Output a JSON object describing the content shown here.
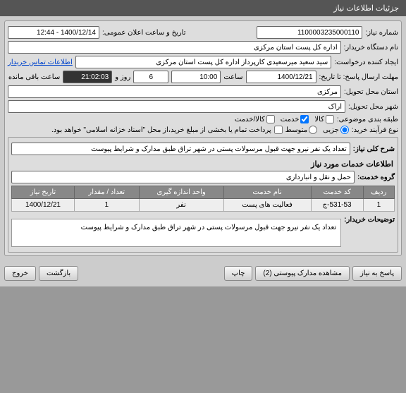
{
  "titlebar": "جزئیات اطلاعات نیاز",
  "fields": {
    "need_no_label": "شماره نیاز:",
    "need_no": "1100003235000110",
    "announce_label": "تاریخ و ساعت اعلان عمومی:",
    "announce_value": "1400/12/14 - 12:44",
    "buyer_label": "نام دستگاه خریدار:",
    "buyer_value": "اداره کل پست استان مرکزی",
    "requester_label": "ایجاد کننده درخواست:",
    "requester_value": "سید سعید میرسعیدی کارپرداز اداره کل پست استان مرکزی",
    "contact_link": "اطلاعات تماس خریدار",
    "deadline_label": "مهلت ارسال پاسخ: تا تاریخ:",
    "deadline_date": "1400/12/21",
    "time_label": "ساعت",
    "deadline_time": "10:00",
    "days_label": "روز و",
    "days_value": "6",
    "remain_time": "21:02:03",
    "remain_label": "ساعت باقی مانده",
    "province_label": "استان محل تحویل:",
    "province_value": "مرکزی",
    "city_label": "شهر محل تحویل:",
    "city_value": "اراک",
    "class_label": "طبقه بندی موضوعی:",
    "class_opt1": "کالا",
    "class_opt2": "خدمت",
    "class_opt3": "کالا/خدمت",
    "purchase_type_label": "نوع فرآیند خرید:",
    "pt_opt1": "جزیی",
    "pt_opt2": "متوسط",
    "pt_note": "پرداخت تمام یا بخشی از مبلغ خرید،از محل \"اسناد خزانه اسلامی\" خواهد بود.",
    "general_desc_label": "شرح کلی نیاز:",
    "general_desc_value": "تعداد یک نفر نیرو جهت قبول مرسولات پستی در شهر تراق طبق مدارک و شرایط پیوست",
    "svc_group_label": "گروه خدمت:",
    "svc_group_value": "حمل و نقل و انبارداری",
    "buyer_note_label": "توضیحات خریدار:",
    "buyer_note_value": "تعداد یک نفر نیرو جهت قبول مرسولات پستی در شهر تراق طبق مدارک و شرایط پیوست"
  },
  "info_heading": "اطلاعات خدمات مورد نیاز",
  "table": {
    "headers": [
      "ردیف",
      "کد خدمت",
      "نام خدمت",
      "واحد اندازه گیری",
      "تعداد / مقدار",
      "تاریخ نیاز"
    ],
    "rows": [
      [
        "1",
        "531-53-ج",
        "فعالیت های پست",
        "نفر",
        "1",
        "1400/12/21"
      ]
    ]
  },
  "buttons": {
    "respond": "پاسخ به نیاز",
    "attachments": "مشاهده مدارک پیوستی (2)",
    "print": "چاپ",
    "back": "بازگشت",
    "exit": "خروج"
  }
}
